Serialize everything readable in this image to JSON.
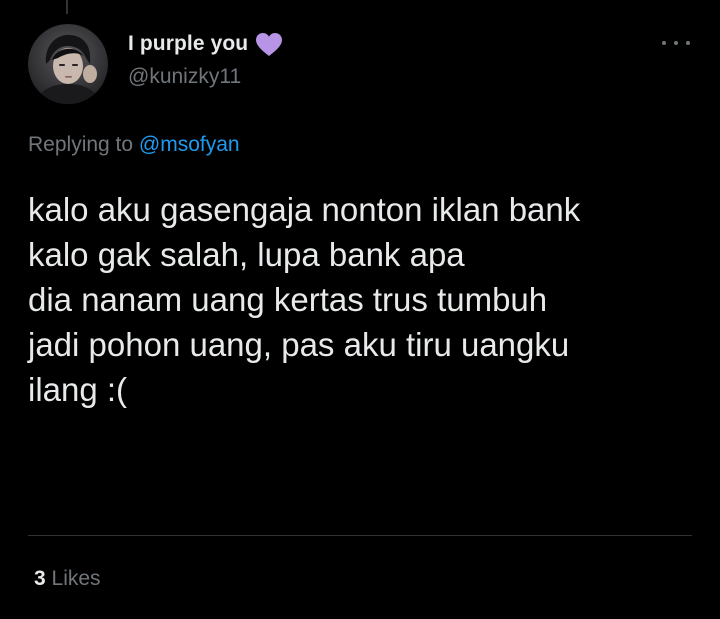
{
  "user": {
    "display_name": "I purple you",
    "handle": "@kunizky11",
    "badge_icon": "purple-heart-icon",
    "badge_color": "#b794e6"
  },
  "reply": {
    "prefix": "Replying to",
    "mention": "@msofyan"
  },
  "tweet": {
    "lines": [
      "kalo aku gasengaja nonton iklan bank",
      "kalo gak salah, lupa bank apa",
      "dia nanam uang kertas trus tumbuh",
      "jadi pohon uang, pas aku tiru uangku",
      "ilang :("
    ]
  },
  "stats": {
    "likes_count": "3",
    "likes_label": "Likes"
  },
  "colors": {
    "background": "#000000",
    "text_primary": "#e7e9ea",
    "text_secondary": "#71767b",
    "link": "#1d9bf0",
    "divider": "#2f3336"
  }
}
